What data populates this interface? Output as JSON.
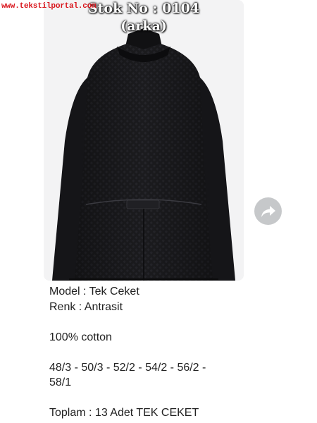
{
  "watermark": {
    "text": "www.tekstilportal.com"
  },
  "message": {
    "image_caption_line1": "Stok No : 0104",
    "image_caption_line2": "(arka)",
    "image_subject": "black jacket back view photo",
    "text_lines": {
      "model": "Model : Tek Ceket",
      "color": "Renk : Antrasit",
      "fabric": "100% cotton",
      "sizes_line1": "48/3 - 50/3 - 52/2 - 54/2 - 56/2 -",
      "sizes_line2": "58/1",
      "total": "Toplam : 13 Adet TEK CEKET"
    }
  },
  "forward_button": {
    "icon": "forward-share-icon"
  },
  "colors": {
    "watermark": "#d9141b",
    "forward_button_bg": "#c6c8ca",
    "text": "#222222"
  }
}
